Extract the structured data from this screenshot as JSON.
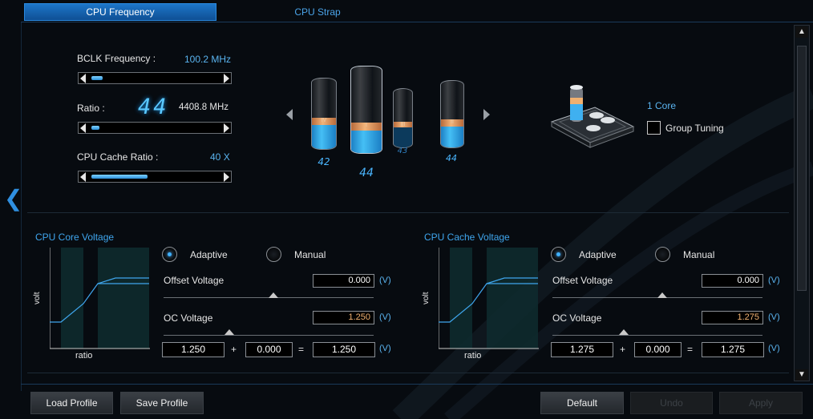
{
  "tabs": [
    {
      "label": "CPU Frequency",
      "active": true
    },
    {
      "label": "CPU Strap",
      "active": false
    }
  ],
  "bclk": {
    "label": "BCLK Frequency :",
    "value": "100.2",
    "unit": "MHz",
    "slider_fraction": 0.08
  },
  "ratio": {
    "label": "Ratio :",
    "big_value": "44",
    "freq": "4408.8",
    "unit": "MHz",
    "slider_fraction": 0.06
  },
  "cache_ratio": {
    "label": "CPU Cache Ratio :",
    "value": "40",
    "unit": "X",
    "slider_fraction": 0.4
  },
  "cores": {
    "items": [
      {
        "num": "42",
        "band": "IV",
        "fill": 0.35
      },
      {
        "num": "44",
        "band": "I",
        "fill": 0.35
      },
      {
        "num": "43",
        "band": "III",
        "fill": 0.35
      },
      {
        "num": "44",
        "band": "II",
        "fill": 0.35
      }
    ],
    "selected_label": "1 Core",
    "group_tuning_label": "Group Tuning",
    "group_tuning_checked": false
  },
  "core_voltage": {
    "title": "CPU Core Voltage",
    "y_label": "volt",
    "x_label": "ratio",
    "adaptive_label": "Adaptive",
    "manual_label": "Manual",
    "mode": "Adaptive",
    "offset_label": "Offset Voltage",
    "offset_value": "0.000",
    "oc_label": "OC Voltage",
    "oc_value": "1.250",
    "sum_a": "1.250",
    "sum_b": "0.000",
    "sum_result": "1.250",
    "unit": "(V)",
    "plus": "+",
    "equals": "="
  },
  "cache_voltage": {
    "title": "CPU Cache Voltage",
    "y_label": "volt",
    "x_label": "ratio",
    "adaptive_label": "Adaptive",
    "manual_label": "Manual",
    "mode": "Adaptive",
    "offset_label": "Offset Voltage",
    "offset_value": "0.000",
    "oc_label": "OC Voltage",
    "oc_value": "1.275",
    "sum_a": "1.275",
    "sum_b": "0.000",
    "sum_result": "1.275",
    "unit": "(V)",
    "plus": "+",
    "equals": "="
  },
  "buttons": {
    "load_profile": "Load Profile",
    "save_profile": "Save Profile",
    "default": "Default",
    "undo": "Undo",
    "apply": "Apply"
  },
  "icons": {
    "nav_back": "chevron-left-icon",
    "prev": "triangle-left-icon",
    "next": "triangle-right-icon",
    "scroll_up": "triangle-up-icon",
    "scroll_down": "triangle-down-icon",
    "chip": "cpu-chip-icon"
  },
  "colors": {
    "accent": "#1d76c9",
    "highlight": "#3fa6ee",
    "oc_value": "#f0b070"
  }
}
